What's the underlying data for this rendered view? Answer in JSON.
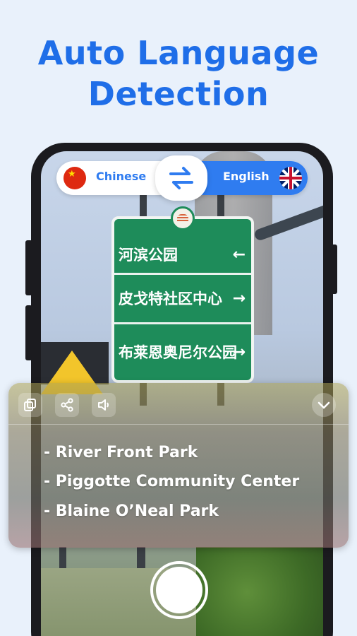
{
  "headline": {
    "line1": "Auto Language",
    "line2": "Detection"
  },
  "language_bar": {
    "source_language": "Chinese",
    "target_language": "English",
    "source_flag": "china-flag-icon",
    "target_flag": "uk-flag-icon",
    "swap_icon": "swap-arrows-icon"
  },
  "camera_scene": {
    "sign_lines": [
      "河滨公园",
      "皮戈特社区中心",
      "布莱恩奥尼尔公园"
    ],
    "sign_arrows": [
      "←",
      "→",
      "→"
    ]
  },
  "translation_panel": {
    "tools": [
      "copy-icon",
      "share-icon",
      "speaker-icon"
    ],
    "collapse_icon": "chevron-down-icon",
    "results": [
      "- River Front Park",
      "- Piggotte Community Center",
      "- Blaine O’Neal Park"
    ]
  },
  "colors": {
    "accent": "#2f7cf0",
    "headline": "#1f6ee8",
    "background": "#e9f1fb"
  }
}
